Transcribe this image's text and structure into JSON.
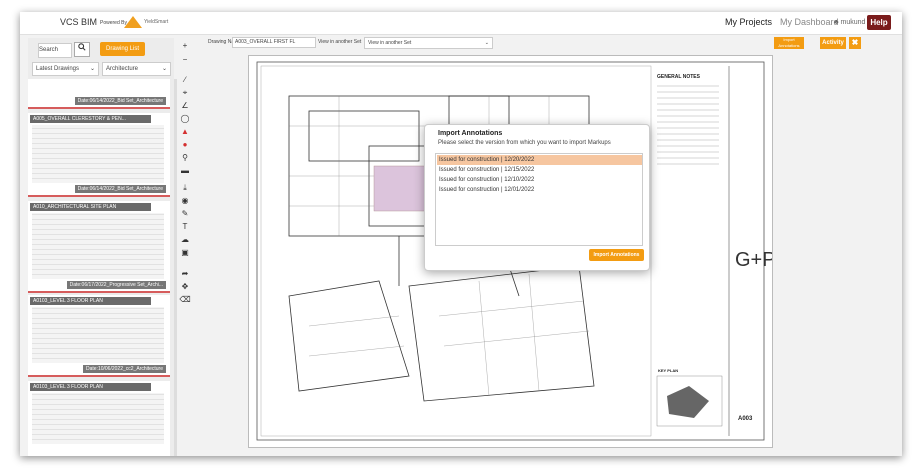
{
  "header": {
    "brand": "VCS BIM",
    "powered_by": "Powered By",
    "logo_text": "YieldSmart",
    "nav_projects": "My Projects",
    "nav_dashboard": "My Dashboard",
    "user": "♣ mukund ▾",
    "help": "Help"
  },
  "sidebar": {
    "search_label": "Search",
    "search_icon": "magnifier",
    "drawing_list_button": "Drawing List",
    "filter_latest": "Latest Drawings",
    "filter_discipline": "Architecture",
    "thumbnails": [
      {
        "title": "",
        "date": "Date:06/14/2022_Bid Set_Architecture"
      },
      {
        "title": "A005_OVERALL CLERESTORY & PEN...",
        "date": "Date:06/14/2022_Bid Set_Architecture"
      },
      {
        "title": "A010_ARCHITECTURAL SITE PLAN",
        "date": "Date:06/17/2022_Progressive Set_Archi..."
      },
      {
        "title": "A0103_LEVEL 3 FLOOR PLAN",
        "date": "Date:10/06/2022_cc2_Architecture"
      },
      {
        "title": "A0103_LEVEL 3 FLOOR PLAN",
        "date": ""
      }
    ]
  },
  "toolbar": {
    "drawing_name_label": "Drawing Name",
    "drawing_name_value": "A003_OVERALL FIRST FL",
    "view_other_label": "View in another Set",
    "view_other_select": "View in another Set",
    "import_annotations_small": "Import Annotations",
    "activity": "Activity",
    "close": "✖"
  },
  "drawing": {
    "general_notes": "GENERAL NOTES",
    "key_plan": "KEY PLAN",
    "sheet_number": "A003"
  },
  "modal": {
    "title": "Import Annotations",
    "subtitle": "Please select the version from which you want to import Markups",
    "versions": [
      "Issued for construction | 12/20/2022",
      "Issued for construction | 12/15/2022",
      "Issued for construction | 12/10/2022",
      "Issued for construction | 12/01/2022"
    ],
    "import_button": "Import Annotations"
  },
  "colors": {
    "accent": "#f39c12",
    "help": "#7a1c1c",
    "selected_row": "#f6c6a0"
  }
}
